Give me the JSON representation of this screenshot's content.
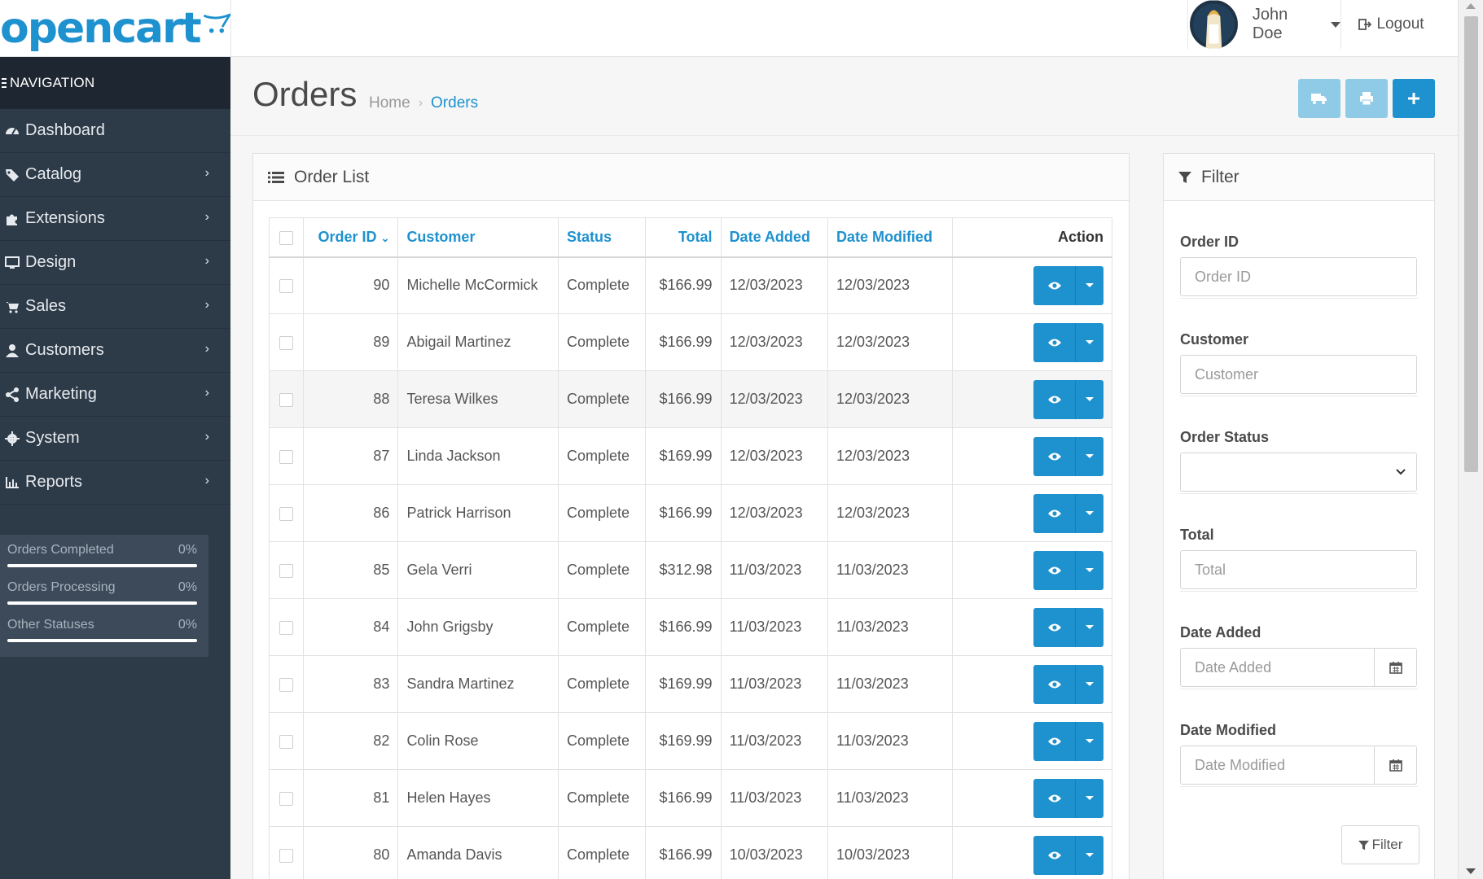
{
  "brand": {
    "logo_text": "opencart"
  },
  "colors": {
    "accent": "#1e91cf",
    "sidebar_bg": "#2d3a48",
    "sidebar_heading_bg": "#1e2731",
    "light_button": "#8fcbe6"
  },
  "header": {
    "user_name": "John Doe",
    "logout_label": "Logout"
  },
  "sidebar": {
    "heading": "NAVIGATION",
    "items": [
      {
        "label": "Dashboard",
        "icon": "dashboard-icon",
        "has_submenu": false
      },
      {
        "label": "Catalog",
        "icon": "tags-icon",
        "has_submenu": true
      },
      {
        "label": "Extensions",
        "icon": "puzzle-icon",
        "has_submenu": true
      },
      {
        "label": "Design",
        "icon": "monitor-icon",
        "has_submenu": true
      },
      {
        "label": "Sales",
        "icon": "cart-icon",
        "has_submenu": true
      },
      {
        "label": "Customers",
        "icon": "user-icon",
        "has_submenu": true
      },
      {
        "label": "Marketing",
        "icon": "share-icon",
        "has_submenu": true
      },
      {
        "label": "System",
        "icon": "gear-icon",
        "has_submenu": true
      },
      {
        "label": "Reports",
        "icon": "bar-chart-icon",
        "has_submenu": true
      }
    ],
    "stats": [
      {
        "label": "Orders Completed",
        "value": "0%"
      },
      {
        "label": "Orders Processing",
        "value": "0%"
      },
      {
        "label": "Other Statuses",
        "value": "0%"
      }
    ]
  },
  "page": {
    "title": "Orders",
    "breadcrumb": {
      "home": "Home",
      "separator": "›",
      "current": "Orders"
    }
  },
  "order_list": {
    "heading": "Order List",
    "columns": {
      "order_id": "Order ID",
      "customer": "Customer",
      "status": "Status",
      "total": "Total",
      "date_added": "Date Added",
      "date_modified": "Date Modified",
      "action": "Action"
    },
    "rows": [
      {
        "id": "90",
        "customer": "Michelle McCormick",
        "status": "Complete",
        "total": "$166.99",
        "date_added": "12/03/2023",
        "date_modified": "12/03/2023"
      },
      {
        "id": "89",
        "customer": "Abigail Martinez",
        "status": "Complete",
        "total": "$166.99",
        "date_added": "12/03/2023",
        "date_modified": "12/03/2023"
      },
      {
        "id": "88",
        "customer": "Teresa Wilkes",
        "status": "Complete",
        "total": "$166.99",
        "date_added": "12/03/2023",
        "date_modified": "12/03/2023"
      },
      {
        "id": "87",
        "customer": "Linda Jackson",
        "status": "Complete",
        "total": "$169.99",
        "date_added": "12/03/2023",
        "date_modified": "12/03/2023"
      },
      {
        "id": "86",
        "customer": "Patrick Harrison",
        "status": "Complete",
        "total": "$166.99",
        "date_added": "12/03/2023",
        "date_modified": "12/03/2023"
      },
      {
        "id": "85",
        "customer": "Gela Verri",
        "status": "Complete",
        "total": "$312.98",
        "date_added": "11/03/2023",
        "date_modified": "11/03/2023"
      },
      {
        "id": "84",
        "customer": "John Grigsby",
        "status": "Complete",
        "total": "$166.99",
        "date_added": "11/03/2023",
        "date_modified": "11/03/2023"
      },
      {
        "id": "83",
        "customer": "Sandra Martinez",
        "status": "Complete",
        "total": "$169.99",
        "date_added": "11/03/2023",
        "date_modified": "11/03/2023"
      },
      {
        "id": "82",
        "customer": "Colin Rose",
        "status": "Complete",
        "total": "$169.99",
        "date_added": "11/03/2023",
        "date_modified": "11/03/2023"
      },
      {
        "id": "81",
        "customer": "Helen Hayes",
        "status": "Complete",
        "total": "$166.99",
        "date_added": "11/03/2023",
        "date_modified": "11/03/2023"
      },
      {
        "id": "80",
        "customer": "Amanda Davis",
        "status": "Complete",
        "total": "$166.99",
        "date_added": "10/03/2023",
        "date_modified": "10/03/2023"
      }
    ]
  },
  "filter": {
    "heading": "Filter",
    "order_id_label": "Order ID",
    "order_id_placeholder": "Order ID",
    "customer_label": "Customer",
    "customer_placeholder": "Customer",
    "status_label": "Order Status",
    "status_value": "",
    "total_label": "Total",
    "total_placeholder": "Total",
    "date_added_label": "Date Added",
    "date_added_placeholder": "Date Added",
    "date_modified_label": "Date Modified",
    "date_modified_placeholder": "Date Modified",
    "button_label": "Filter"
  }
}
